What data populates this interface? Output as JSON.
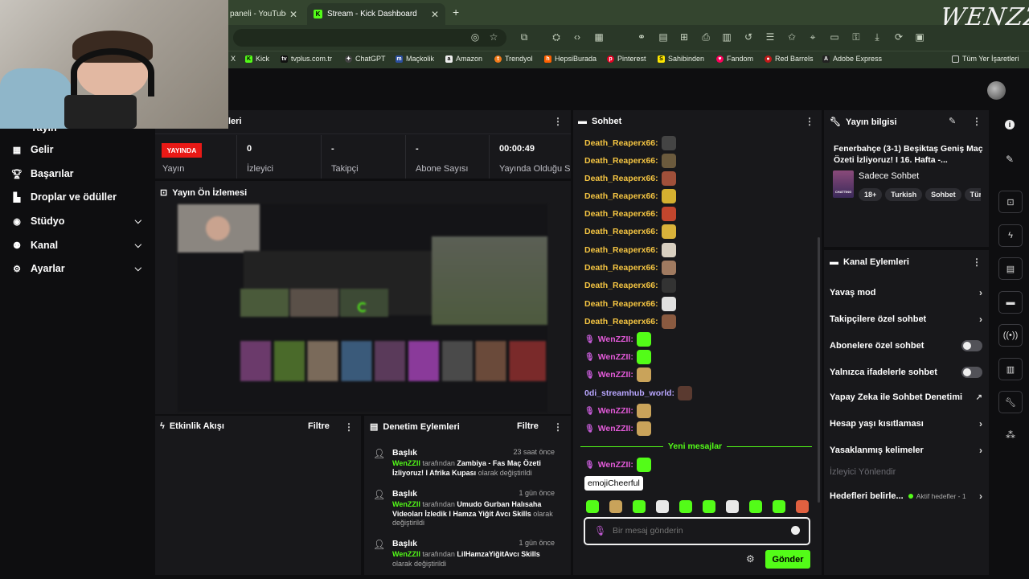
{
  "browser": {
    "tabs": [
      {
        "label": "paneli - YouTube",
        "close": "✕"
      },
      {
        "label": "Stream - Kick Dashboard",
        "close": "✕"
      }
    ],
    "new_tab": "+",
    "bookmarks": [
      {
        "label": "X",
        "icon": "x-icon"
      },
      {
        "label": "Kick",
        "icon": "kick-icon"
      },
      {
        "label": "tvplus.com.tr",
        "icon": "tvplus-icon"
      },
      {
        "label": "ChatGPT",
        "icon": "chatgpt-icon"
      },
      {
        "label": "Maçkolik",
        "icon": "mackolik-icon"
      },
      {
        "label": "Amazon",
        "icon": "amazon-icon"
      },
      {
        "label": "Trendyol",
        "icon": "trendyol-icon"
      },
      {
        "label": "HepsiBurada",
        "icon": "hepsiburada-icon"
      },
      {
        "label": "Pinterest",
        "icon": "pinterest-icon"
      },
      {
        "label": "Sahibinden",
        "icon": "sahibinden-icon"
      },
      {
        "label": "Fandom",
        "icon": "fandom-icon"
      },
      {
        "label": "Red Barrels",
        "icon": "redbarrels-icon"
      },
      {
        "label": "Adobe Express",
        "icon": "adobe-icon"
      },
      {
        "label": "Tüm Yer İşaretleri",
        "icon": "folder-icon"
      }
    ]
  },
  "watermark": "WENZZII",
  "sidebar": {
    "partial_item": "Yayın",
    "items": [
      {
        "label": "Gelir",
        "icon": "revenue-icon"
      },
      {
        "label": "Başarılar",
        "icon": "trophy-icon"
      },
      {
        "label": "Droplar ve ödüller",
        "icon": "gift-icon"
      },
      {
        "label": "Stüdyo",
        "icon": "studio-icon",
        "expandable": true
      },
      {
        "label": "Kanal",
        "icon": "channel-icon",
        "expandable": true
      },
      {
        "label": "Ayarlar",
        "icon": "gear-icon",
        "expandable": true
      }
    ]
  },
  "stats_panel": {
    "title": "Yayın Detayları",
    "title_visible": "lerі",
    "live_badge": "YAYINDA",
    "stats": [
      {
        "label": "Yayın",
        "value": ""
      },
      {
        "label": "İzleyici",
        "value": "0"
      },
      {
        "label": "Takipçi",
        "value": "-"
      },
      {
        "label": "Abone Sayısı",
        "value": "-"
      },
      {
        "label": "Yayında Olduğu Sü",
        "value": "00:00:49"
      }
    ]
  },
  "preview_panel": {
    "title": "Yayın Ön İzlemesi"
  },
  "activity_panel": {
    "title": "Etkinlik Akışı",
    "filter": "Filtre"
  },
  "mod_panel": {
    "title": "Denetim Eylemleri",
    "filter": "Filtre",
    "items": [
      {
        "title": "Başlık",
        "time": "23 saat önce",
        "user": "WenZZII",
        "mid": " tarafından ",
        "value": "Zambiya - Fas Maç Özeti İzliyoruz! I Afrika Kupası",
        "suffix": " olarak değiştirildi"
      },
      {
        "title": "Başlık",
        "time": "1 gün önce",
        "user": "WenZZII",
        "mid": " tarafından ",
        "value": "Umudo Gurban Halısaha Videoları İzledik I Hamza Yiğit Avcı Skills",
        "suffix": " olarak değiştirildi"
      },
      {
        "title": "Başlık",
        "time": "1 gün önce",
        "user": "WenZZII",
        "mid": " tarafından ",
        "value": "LilHamzaYiğitAvcı Skills",
        "suffix": " olarak değiştirildi"
      }
    ]
  },
  "chat": {
    "title": "Sohbet",
    "messages": [
      {
        "user": "Death_Reaperx66:",
        "kind": "yellow",
        "emote": "#444444"
      },
      {
        "user": "Death_Reaperx66:",
        "kind": "yellow",
        "emote": "#6b5a3d"
      },
      {
        "user": "Death_Reaperx66:",
        "kind": "yellow",
        "emote": "#a0503a"
      },
      {
        "user": "Death_Reaperx66:",
        "kind": "yellow",
        "emote": "#d4b030"
      },
      {
        "user": "Death_Reaperx66:",
        "kind": "yellow",
        "emote": "#c2462d"
      },
      {
        "user": "Death_Reaperx66:",
        "kind": "yellow",
        "emote": "#d9b23a"
      },
      {
        "user": "Death_Reaperx66:",
        "kind": "yellow",
        "emote": "#d8cfc0"
      },
      {
        "user": "Death_Reaperx66:",
        "kind": "yellow",
        "emote": "#a07a60"
      },
      {
        "user": "Death_Reaperx66:",
        "kind": "yellow",
        "emote": "#333333"
      },
      {
        "user": "Death_Reaperx66:",
        "kind": "yellow",
        "emote": "#e0e0e0"
      },
      {
        "user": "Death_Reaperx66:",
        "kind": "yellow",
        "emote": "#8a5a40"
      },
      {
        "user": "WenZZII:",
        "kind": "purple",
        "emote": "#53fc18"
      },
      {
        "user": "WenZZII:",
        "kind": "purple",
        "emote": "#53fc18"
      },
      {
        "user": "WenZZII:",
        "kind": "purple",
        "emote": "#c9a35a"
      },
      {
        "user": "0di_streamhub_world:",
        "kind": "violet",
        "emote": "#5a3a30"
      },
      {
        "user": "WenZZII:",
        "kind": "purple",
        "emote": "#c9a35a"
      },
      {
        "user": "WenZZII:",
        "kind": "purple",
        "emote": "#c9a35a"
      }
    ],
    "new_messages": "Yeni mesajlar",
    "after_new": {
      "user": "WenZZII:",
      "emote": "#53fc18"
    },
    "tooltip": "emojiCheerful",
    "emote_bar": [
      "#53fc18",
      "#c9a35a",
      "#53fc18",
      "#e8e8e8",
      "#53fc18",
      "#53fc18",
      "#e8e8e8",
      "#53fc18",
      "#53fc18",
      "#e06040"
    ],
    "input_placeholder": "Bir mesaj gönderin",
    "send": "Gönder"
  },
  "stream_info": {
    "title": "Yayın bilgisi",
    "stream_title": "Fenerbahçe (3-1) Beşiktaş Geniş Maç Özeti İzliyoruz! I 16. Hafta -...",
    "category": "Sadece Sohbet",
    "category_thumb": "CHATTING",
    "tags": [
      "18+",
      "Turkish",
      "Sohbet",
      "Tür"
    ]
  },
  "channel_actions": {
    "title": "Kanal Eylemleri",
    "items": [
      {
        "label": "Yavaş mod",
        "control": "chevron"
      },
      {
        "label": "Takipçilere özel sohbet",
        "control": "chevron"
      },
      {
        "label": "Abonelere özel sohbet",
        "control": "toggle"
      },
      {
        "label": "Yalnızca ifadelerle sohbet",
        "control": "toggle"
      },
      {
        "label": "Yapay Zeka ile Sohbet Denetimi",
        "control": "external"
      },
      {
        "label": "Hesap yaşı kısıtlaması",
        "control": "chevron"
      },
      {
        "label": "Yasaklanmış kelimeler",
        "control": "chevron"
      }
    ],
    "disabled_item": "İzleyici Yönlendir",
    "goals": {
      "label": "Hedefleri belirle...",
      "status": "Aktif hedefler - 1"
    }
  },
  "right_rail": [
    "info-icon",
    "pencil-icon",
    "scan-icon",
    "lightning-icon",
    "note-icon",
    "chat-icon",
    "broadcast-icon",
    "layout-icon",
    "wrench-icon",
    "apps-icon"
  ]
}
